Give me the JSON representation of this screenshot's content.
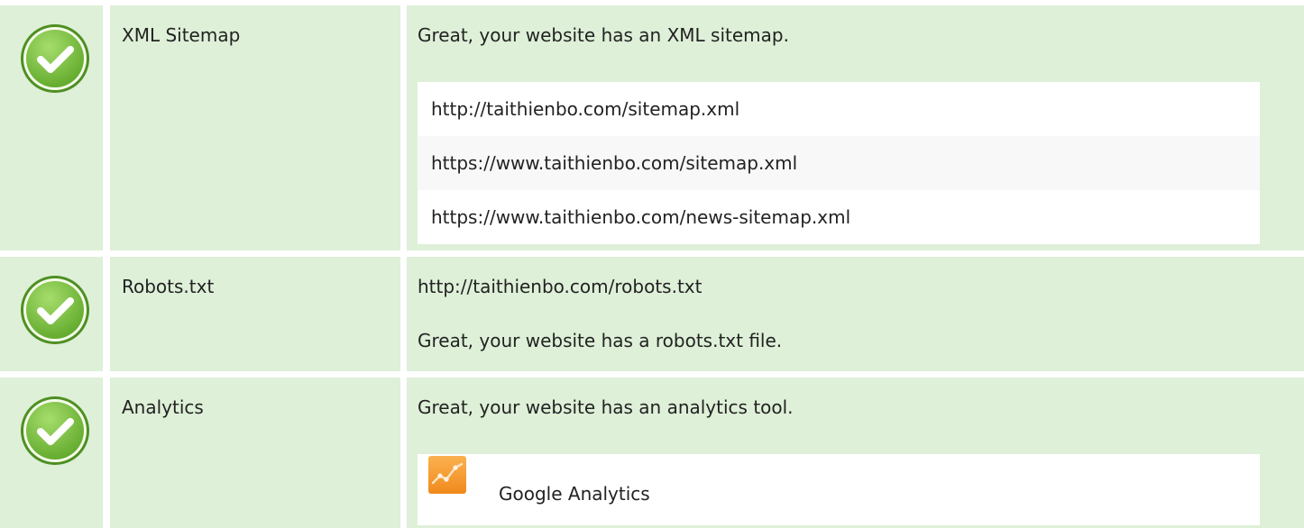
{
  "checks": [
    {
      "label": "XML Sitemap",
      "message": "Great, your website has an XML sitemap.",
      "status_icon": "check-circle-icon",
      "sitemaps": [
        "http://taithienbo.com/sitemap.xml",
        "https://www.taithienbo.com/sitemap.xml",
        "https://www.taithienbo.com/news-sitemap.xml"
      ]
    },
    {
      "label": "Robots.txt",
      "status_icon": "check-circle-icon",
      "robots_url": "http://taithienbo.com/robots.txt",
      "message": "Great, your website has a robots.txt file."
    },
    {
      "label": "Analytics",
      "status_icon": "check-circle-icon",
      "message": "Great, your website has an analytics tool.",
      "tool": {
        "name": "Google Analytics",
        "icon": "google-analytics-icon"
      }
    }
  ],
  "colors": {
    "row_background": "#def0d8",
    "check_green_light": "#8fd05a",
    "check_green_dark": "#4e9a1e",
    "analytics_orange": "#f7901e"
  }
}
